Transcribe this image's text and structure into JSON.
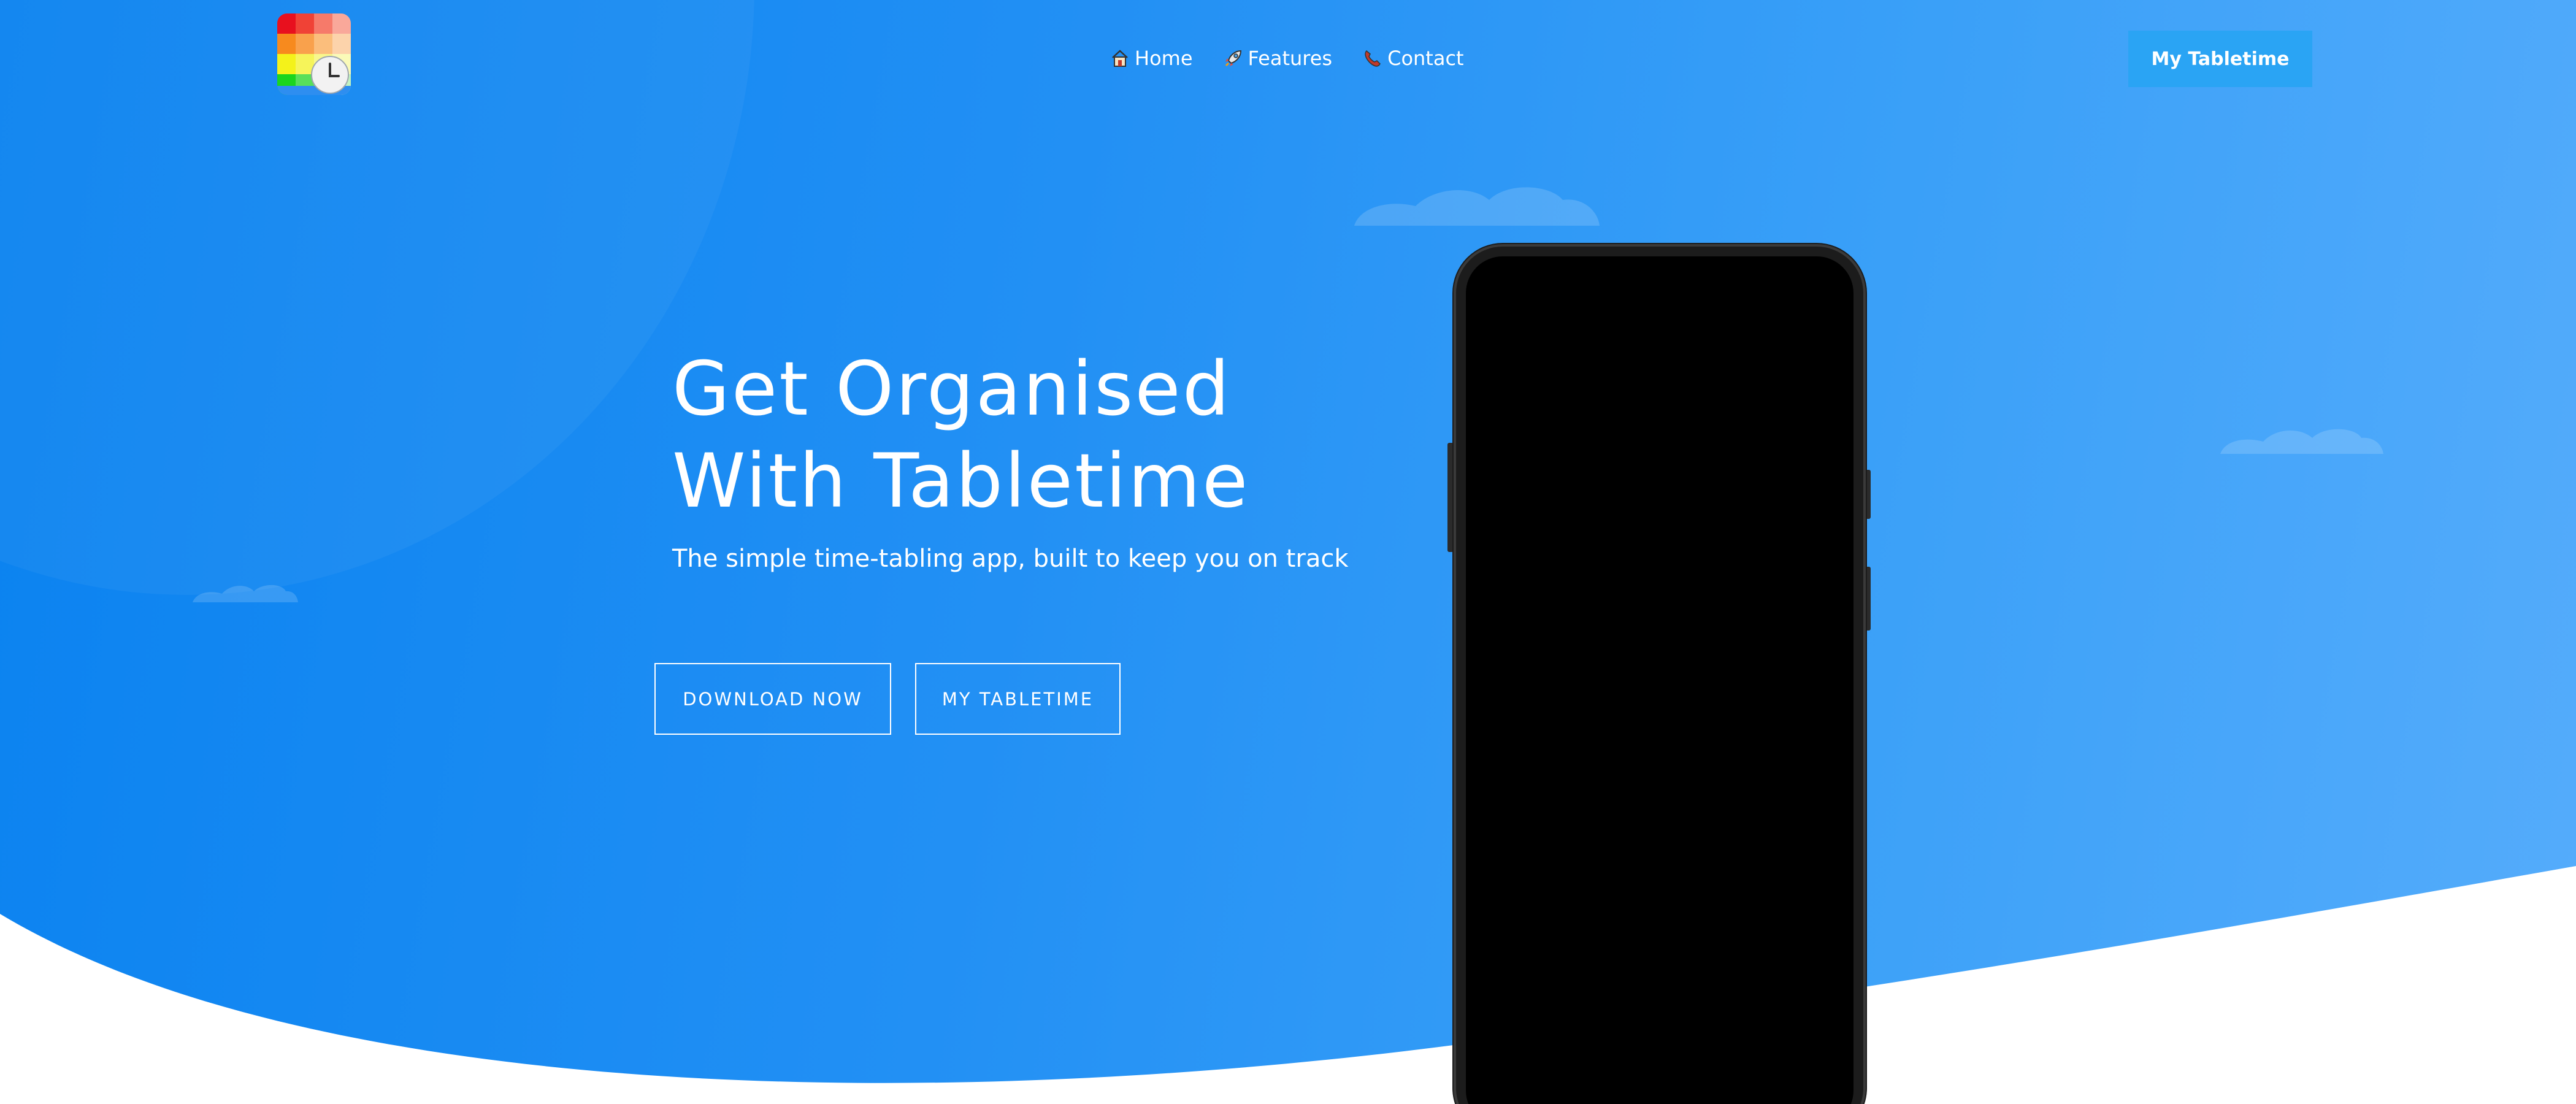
{
  "header": {
    "logo_label": "Tabletime logo",
    "nav": [
      {
        "label": "Home",
        "icon": "house-icon"
      },
      {
        "label": "Features",
        "icon": "rocket-icon"
      },
      {
        "label": "Contact",
        "icon": "phone-icon"
      }
    ],
    "account_button": "My Tabletime"
  },
  "hero": {
    "title_line1": "Get Organised",
    "title_line2": "With Tabletime",
    "subtitle": "The simple time-tabling app, built to keep you on track",
    "buttons": {
      "download": "DOWNLOAD NOW",
      "my_tabletime": "MY TABLETIME"
    }
  },
  "colors": {
    "gradient_start": "#0a82f0",
    "gradient_end": "#55acfb",
    "header_button": "#2aa4f4",
    "phone_screen": "#000000"
  }
}
